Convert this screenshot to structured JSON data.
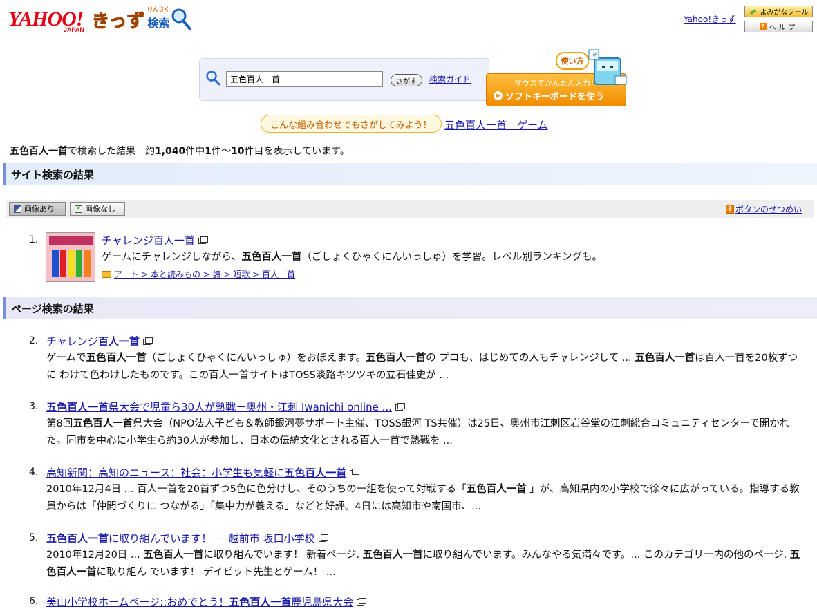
{
  "header": {
    "logo_main": "YAHOO!",
    "logo_sub": "JAPAN",
    "logo_kids": "きっず",
    "logo_search": "検索",
    "logo_search_ruby": "けんさく",
    "kids_link": "Yahoo!きっず",
    "yomigana_button": "よみがなツール",
    "help_button": "ヘルプ"
  },
  "search": {
    "query": "五色百人一首",
    "submit_label": "さがす",
    "guide_link": "検索ガイド",
    "howto_label": "使い方",
    "softkb_line1": "マウスでかんたん入力！",
    "softkb_line2": "ソフトキーボードを使う"
  },
  "suggest": {
    "label": "こんな組み合わせでもさがしてみよう！",
    "link": "五色百人一首　ゲーム"
  },
  "summary": {
    "query": "五色百人一首",
    "text1": "で検索した結果　約",
    "total": "1,040",
    "text2": "件中",
    "from": "1",
    "text3": "件～",
    "to": "10",
    "text4": "件目を表示しています。"
  },
  "site_section": {
    "heading": "サイト検索の結果",
    "btn_images_on": "画像あり",
    "btn_images_off": "画像なし",
    "btn_explain": "ボタンのせつめい",
    "result": {
      "num": "1.",
      "title": "チャレンジ百人一首",
      "desc_pre": "ゲームにチャレンジしながら、",
      "desc_bold": "五色百人一首",
      "desc_post": "（ごしょくひゃくにんいっしゅ）を学習。レベル別ランキングも。",
      "category": "アート > 本と読みもの > 詩 > 短歌 > 百人一首"
    }
  },
  "page_section": {
    "heading": "ページ検索の結果",
    "results": [
      {
        "num": "2.",
        "title": [
          {
            "t": "チャレンジ"
          },
          {
            "t": "百人一首",
            "b": true
          }
        ],
        "desc": [
          {
            "t": "ゲームで"
          },
          {
            "t": "五色百人一首",
            "b": true
          },
          {
            "t": "（ごしょくひゃくにんいっしゅ）をおぼえます。"
          },
          {
            "t": "五色百人一首",
            "b": true
          },
          {
            "t": "の プロも、はじめての人もチャレンジして ... "
          },
          {
            "t": "五色百人一首",
            "b": true
          },
          {
            "t": "は百人一首を20枚ずつに わけて色わけしたものです。この百人一首サイトはTOSS淡路キツツキの立石佳史が ..."
          }
        ]
      },
      {
        "num": "3.",
        "title": [
          {
            "t": "五色百人一首",
            "b": true
          },
          {
            "t": "県大会で児童ら30人が熱戦－奥州・江刺 Iwanichi online ..."
          }
        ],
        "desc": [
          {
            "t": "第8回"
          },
          {
            "t": "五色百人一首",
            "b": true
          },
          {
            "t": "県大会（NPO法人子ども＆教師銀河夢サポート主催、TOSS銀河 TS共催）は25日、奥州市江刺区岩谷堂の江刺総合コミュニティセンターで開かれた。同市を中心に小学生ら約30人が参加し、日本の伝統文化とされる百人一首で熱戦を ..."
          }
        ]
      },
      {
        "num": "4.",
        "title": [
          {
            "t": "高知新聞：高知のニュース：社会：小学生も気軽に"
          },
          {
            "t": "五色百人一首",
            "b": true
          }
        ],
        "desc": [
          {
            "t": "2010年12月4日 ... 百人一首を20首ずつ5色に色分けし、そのうちの一組を使って対戦する「"
          },
          {
            "t": "五色百人一首",
            "b": true
          },
          {
            "t": " 」が、高知県内の小学校で徐々に広がっている。指導する教員からは「仲間づくりに つながる」「集中力が養える」などと好評。4日には高知市や南国市、..."
          }
        ]
      },
      {
        "num": "5.",
        "title": [
          {
            "t": "五色百人一首",
            "b": true
          },
          {
            "t": "に取り組んでいます！ － 越前市 坂口小学校"
          }
        ],
        "desc": [
          {
            "t": "2010年12月20日 ... "
          },
          {
            "t": "五色百人一首",
            "b": true
          },
          {
            "t": "に取り組んでいます！ 新着ページ. "
          },
          {
            "t": "五色百人一首",
            "b": true
          },
          {
            "t": "に取り組んでいます。みんなやる気満々です。... このカテゴリー内の他のページ. "
          },
          {
            "t": "五色百人一首",
            "b": true
          },
          {
            "t": "に取り組ん でいます！ デイビット先生とゲーム！ ..."
          }
        ]
      },
      {
        "num": "6.",
        "title": [
          {
            "t": "美山小学校ホームページ::おめでとう！"
          },
          {
            "t": "五色百人一首",
            "b": true
          },
          {
            "t": "鹿児島県大会"
          }
        ],
        "desc": []
      }
    ]
  },
  "colors": {
    "link": "#1a1aa6",
    "brand_red": "#e60012",
    "accent_orange": "#f08c00",
    "section_site_bg": "#e2ecfa",
    "section_page_bg": "#e8e8f8"
  }
}
